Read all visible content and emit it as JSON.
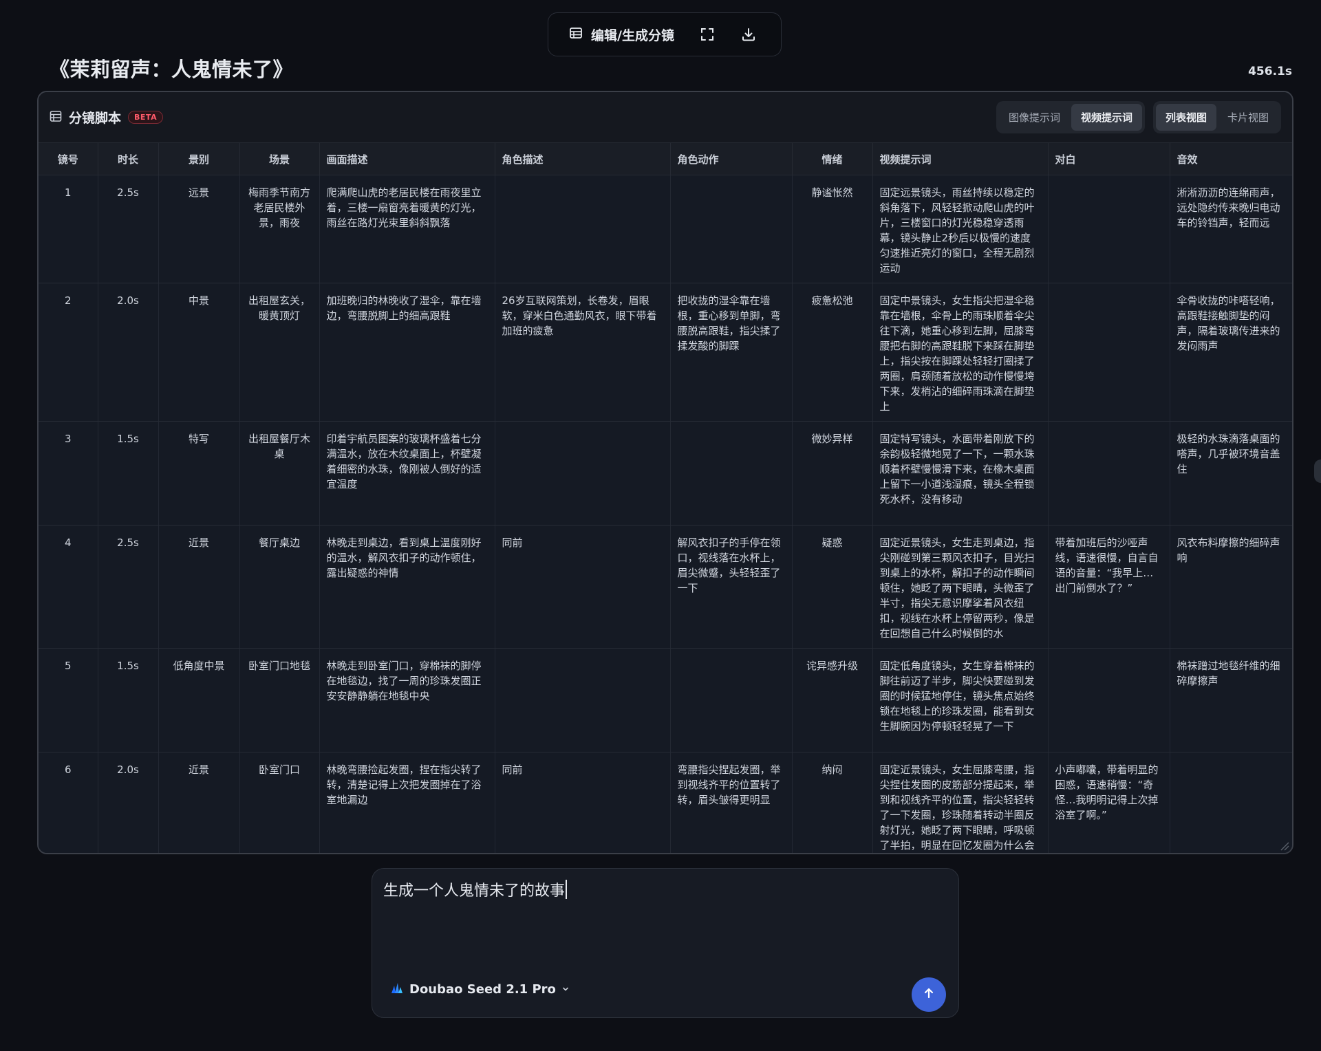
{
  "toolbar": {
    "edit_label": "编辑/生成分镜"
  },
  "story_title": "《茉莉留声：人鬼情未了》",
  "elapsed": "456.1s",
  "panel": {
    "title": "分镜脚本",
    "badge": "BETA",
    "prompt_tabs": [
      "图像提示词",
      "视频提示词"
    ],
    "active_prompt_tab": "视频提示词",
    "view_tabs": [
      "列表视图",
      "卡片视图"
    ],
    "active_view_tab": "列表视图"
  },
  "table": {
    "headers": [
      "镜号",
      "时长",
      "景别",
      "场景",
      "画面描述",
      "角色描述",
      "角色动作",
      "情绪",
      "视频提示词",
      "对白",
      "音效"
    ],
    "rows": [
      [
        "1",
        "2.5s",
        "远景",
        "梅雨季节南方老居民楼外景，雨夜",
        "爬满爬山虎的老居民楼在雨夜里立着，三楼一扇窗亮着暖黄的灯光，雨丝在路灯光束里斜斜飘落",
        "",
        "",
        "静谧怅然",
        "固定远景镜头，雨丝持续以稳定的斜角落下，风轻轻掀动爬山虎的叶片，三楼窗口的灯光稳稳穿透雨幕，镜头静止2秒后以极慢的速度匀速推近亮灯的窗口，全程无剧烈运动",
        "",
        "淅淅沥沥的连绵雨声，远处隐约传来晚归电动车的铃铛声，轻而远"
      ],
      [
        "2",
        "2.0s",
        "中景",
        "出租屋玄关，暖黄顶灯",
        "加班晚归的林晚收了湿伞，靠在墙边，弯腰脱脚上的细高跟鞋",
        "26岁互联网策划，长卷发，眉眼软，穿米白色通勤风衣，眼下带着加班的疲惫",
        "把收拢的湿伞靠在墙根，重心移到单脚，弯腰脱高跟鞋，指尖揉了揉发酸的脚踝",
        "疲惫松弛",
        "固定中景镜头，女生指尖把湿伞稳靠在墙根，伞骨上的雨珠顺着伞尖往下滴，她重心移到左脚，屈膝弯腰把右脚的高跟鞋脱下来踩在脚垫上，指尖按在脚踝处轻轻打圈揉了两圈，肩颈随着放松的动作慢慢垮下来，发梢沾的细碎雨珠滴在脚垫上",
        "",
        "伞骨收拢的咔嗒轻响，高跟鞋接触脚垫的闷声，隔着玻璃传进来的发闷雨声"
      ],
      [
        "3",
        "1.5s",
        "特写",
        "出租屋餐厅木桌",
        "印着宇航员图案的玻璃杯盛着七分满温水，放在木纹桌面上，杯壁凝着细密的水珠，像刚被人倒好的适宜温度",
        "",
        "",
        "微妙异样",
        "固定特写镜头，水面带着刚放下的余韵极轻微地晃了一下，一颗水珠顺着杯壁慢慢滑下来，在橡木桌面上留下一小道浅湿痕，镜头全程锁死水杯，没有移动",
        "",
        "极轻的水珠滴落桌面的嗒声，几乎被环境音盖住"
      ],
      [
        "4",
        "2.5s",
        "近景",
        "餐厅桌边",
        "林晚走到桌边，看到桌上温度刚好的温水，解风衣扣子的动作顿住，露出疑惑的神情",
        "同前",
        "解风衣扣子的手停在领口，视线落在水杯上，眉尖微蹙，头轻轻歪了一下",
        "疑惑",
        "固定近景镜头，女生走到桌边，指尖刚碰到第三颗风衣扣子，目光扫到桌上的水杯，解扣子的动作瞬间顿住，她眨了两下眼睛，头微歪了半寸，指尖无意识摩挲着风衣纽扣，视线在水杯上停留两秒，像是在回想自己什么时候倒的水",
        "带着加班后的沙哑声线，语速很慢，自言自语的音量：“我早上…出门前倒水了？”",
        "风衣布料摩擦的细碎声响"
      ],
      [
        "5",
        "1.5s",
        "低角度中景",
        "卧室门口地毯",
        "林晚走到卧室门口，穿棉袜的脚停在地毯边，找了一周的珍珠发圈正安安静静躺在地毯中央",
        "",
        "",
        "诧异感升级",
        "固定低角度镜头，女生穿着棉袜的脚往前迈了半步，脚尖快要碰到发圈的时候猛地停住，镜头焦点始终锁在地毯上的珍珠发圈，能看到女生脚腕因为停顿轻轻晃了一下",
        "",
        "棉袜蹭过地毯纤维的细碎摩擦声"
      ],
      [
        "6",
        "2.0s",
        "近景",
        "卧室门口",
        "林晚弯腰捡起发圈，捏在指尖转了转，清楚记得上次把发圈掉在了浴室地漏边",
        "同前",
        "弯腰指尖捏起发圈，举到视线齐平的位置转了转，眉头皱得更明显",
        "纳闷",
        "固定近景镜头，女生屈膝弯腰，指尖捏住发圈的皮筋部分提起来，举到和视线齐平的位置，指尖轻轻转了一下发圈，珍珠随着转动半圈反射灯光，她眨了两下眼睛，呼吸顿了半拍，明显在回忆发圈为什么会",
        "小声嘟囔，带着明显的困惑，语速稍慢：“奇怪…我明明记得上次掉浴室了啊。”",
        ""
      ]
    ]
  },
  "prompt": {
    "text": "生成一个人鬼情未了的故事"
  },
  "model": {
    "name": "Doubao Seed 2.1 Pro"
  },
  "colors": {
    "accent": "#3d63d9",
    "beta": "#ff5a6a",
    "bg": "#0d0f15",
    "panel": "#151a24"
  }
}
